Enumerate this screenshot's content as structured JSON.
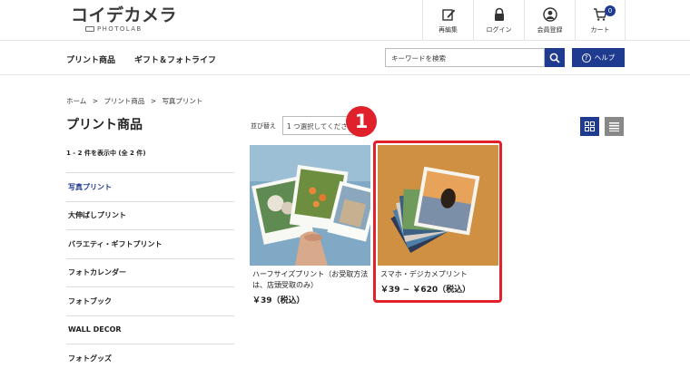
{
  "header": {
    "logo_text": "コイデカメラ",
    "logo_sub": "PHOTOLAB",
    "tools": [
      {
        "label": "再編集",
        "icon": "edit-icon"
      },
      {
        "label": "ログイン",
        "icon": "lock-icon"
      },
      {
        "label": "会員登録",
        "icon": "user-icon"
      },
      {
        "label": "カート",
        "icon": "cart-icon"
      }
    ],
    "cart_count": "0"
  },
  "nav": {
    "items": [
      "プリント商品",
      "ギフト＆フォトライフ"
    ],
    "search_placeholder": "キーワードを検索",
    "help_label": "ヘルプ"
  },
  "breadcrumb": [
    "ホーム",
    ">",
    "プリント商品",
    ">",
    "写真プリント"
  ],
  "page_title": "プリント商品",
  "result_count": "1 - 2 件を表示中 (全 2 件)",
  "sidebar": {
    "items": [
      "写真プリント",
      "大伸ばしプリント",
      "バラエティ・ギフトプリント",
      "フォトカレンダー",
      "フォトブック",
      "WALL DECOR",
      "フォトグッズ"
    ],
    "active_index": 0
  },
  "sort": {
    "label": "並び替え",
    "selected": "1 つ選択してください"
  },
  "products": [
    {
      "name": "ハーフサイズプリント（お受取方法は、店頭受取のみ）",
      "price": "￥39（税込）"
    },
    {
      "name": "スマホ・デジカメプリント",
      "price": "￥39 ~ ￥620（税込）"
    }
  ],
  "step_badge": "1",
  "colors": {
    "accent": "#1f3b8f",
    "highlight": "#e0202a"
  }
}
